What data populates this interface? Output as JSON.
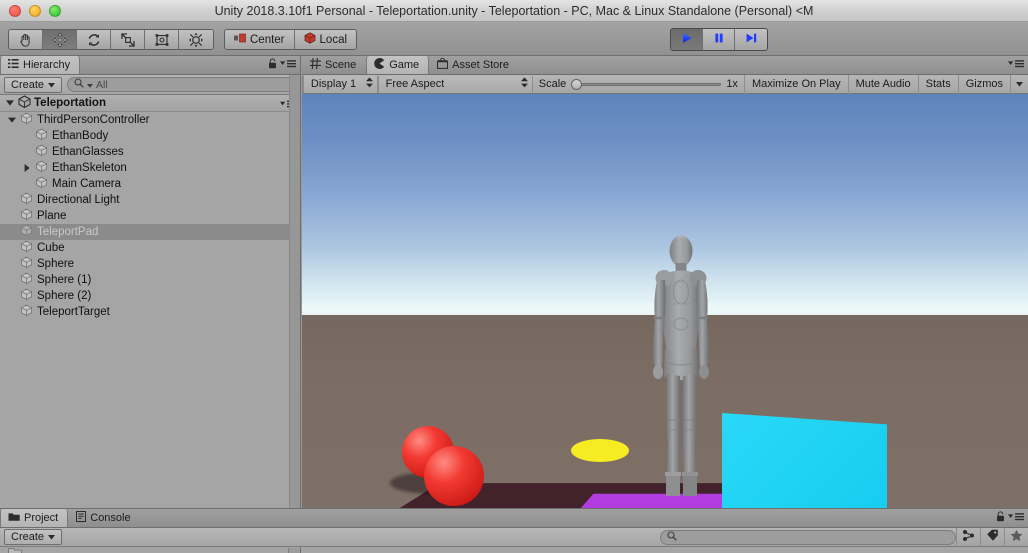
{
  "window": {
    "title": "Unity 2018.3.10f1 Personal - Teleportation.unity - Teleportation - PC, Mac & Linux Standalone (Personal) <M",
    "traffic_lights": [
      "close-red",
      "minimize-yellow",
      "zoom-green"
    ]
  },
  "toolbar": {
    "tools": [
      {
        "name": "hand-tool",
        "icon": "hand-icon",
        "active": false
      },
      {
        "name": "move-tool",
        "icon": "move-arrows-icon",
        "active": true
      },
      {
        "name": "rotate-tool",
        "icon": "rotate-icon",
        "active": false
      },
      {
        "name": "scale-tool",
        "icon": "scale-icon",
        "active": false
      },
      {
        "name": "rect-tool",
        "icon": "rect-transform-icon",
        "active": false
      },
      {
        "name": "transform-tool",
        "icon": "combined-transform-icon",
        "active": false
      }
    ],
    "pivot_label": "Center",
    "space_label": "Local",
    "play_label": "play-icon",
    "pause_label": "pause-icon",
    "step_label": "step-icon",
    "play_active": true
  },
  "hierarchy": {
    "tab_label": "Hierarchy",
    "tab_icon": "hierarchy-icon",
    "create_label": "Create",
    "search_placeholder": "All",
    "search_value": "",
    "scene_name": "Teleportation",
    "items": [
      {
        "label": "ThirdPersonController",
        "depth": 1,
        "twisty": "down",
        "selected": false
      },
      {
        "label": "EthanBody",
        "depth": 2,
        "twisty": "none",
        "selected": false
      },
      {
        "label": "EthanGlasses",
        "depth": 2,
        "twisty": "none",
        "selected": false
      },
      {
        "label": "EthanSkeleton",
        "depth": 2,
        "twisty": "right",
        "selected": false
      },
      {
        "label": "Main Camera",
        "depth": 2,
        "twisty": "none",
        "selected": false
      },
      {
        "label": "Directional Light",
        "depth": 1,
        "twisty": "none",
        "selected": false
      },
      {
        "label": "Plane",
        "depth": 1,
        "twisty": "none",
        "selected": false
      },
      {
        "label": "TeleportPad",
        "depth": 1,
        "twisty": "none",
        "selected": true
      },
      {
        "label": "Cube",
        "depth": 1,
        "twisty": "none",
        "selected": false
      },
      {
        "label": "Sphere",
        "depth": 1,
        "twisty": "none",
        "selected": false
      },
      {
        "label": "Sphere (1)",
        "depth": 1,
        "twisty": "none",
        "selected": false
      },
      {
        "label": "Sphere (2)",
        "depth": 1,
        "twisty": "none",
        "selected": false
      },
      {
        "label": "TeleportTarget",
        "depth": 1,
        "twisty": "none",
        "selected": false
      }
    ]
  },
  "gameview": {
    "tabs": [
      {
        "label": "Scene",
        "icon": "scene-grid-icon",
        "active": false
      },
      {
        "label": "Game",
        "icon": "game-pacman-icon",
        "active": true
      },
      {
        "label": "Asset Store",
        "icon": "asset-store-icon",
        "active": false
      }
    ],
    "display_label": "Display 1",
    "aspect_label": "Free Aspect",
    "scale_label": "Scale",
    "scale_value": "1x",
    "maximize_label": "Maximize On Play",
    "mute_label": "Mute Audio",
    "stats_label": "Stats",
    "gizmos_label": "Gizmos",
    "scene_objects": [
      {
        "name": "ethan-character",
        "color": "#9a9a9c"
      },
      {
        "name": "red-sphere-1",
        "color": "#e22f28"
      },
      {
        "name": "red-sphere-2",
        "color": "#e22f28"
      },
      {
        "name": "yellow-teleport-pad",
        "color": "#f5ec21"
      },
      {
        "name": "cyan-cube",
        "color": "#22d6f5"
      },
      {
        "name": "magenta-plane",
        "color": "#b13ce0"
      },
      {
        "name": "dark-plum-plane",
        "color": "#42232c"
      },
      {
        "name": "ground",
        "color": "#7b6d63"
      },
      {
        "name": "sky",
        "color": "#6e90c4"
      }
    ]
  },
  "project": {
    "tabs": [
      {
        "label": "Project",
        "icon": "folder-icon",
        "active": true
      },
      {
        "label": "Console",
        "icon": "console-icon",
        "active": false
      }
    ],
    "create_label": "Create",
    "search_placeholder": "",
    "search_value": "",
    "icons": [
      "favorites-filter-icon",
      "label-filter-icon",
      "star-icon"
    ]
  },
  "colors": {
    "panel_bg": "#a5a5a5",
    "toolbar_bg": "#9a9a9a",
    "selection": "#8b8b8b",
    "accent_blue": "#1f4dff",
    "titlebar": "#d0d0d0"
  }
}
